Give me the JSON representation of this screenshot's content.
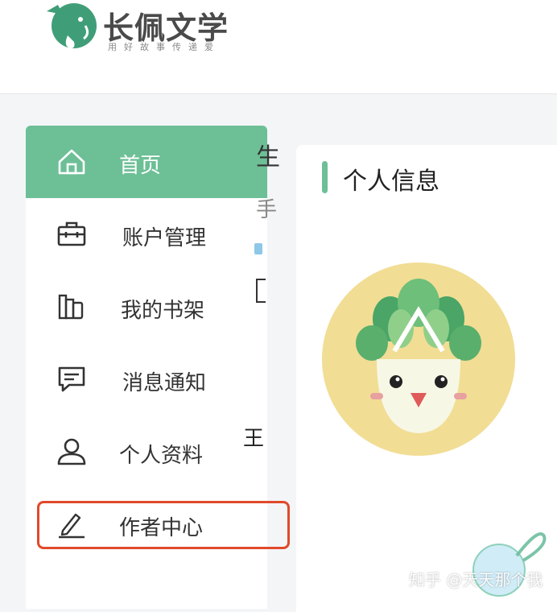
{
  "header": {
    "logo_title": "长佩文学",
    "logo_slogan": "用好故事传递爱"
  },
  "sidebar": {
    "items": [
      {
        "label": "首页",
        "icon": "home-icon",
        "active": true
      },
      {
        "label": "账户管理",
        "icon": "briefcase-icon",
        "active": false
      },
      {
        "label": "我的书架",
        "icon": "bookshelf-icon",
        "active": false
      },
      {
        "label": "消息通知",
        "icon": "message-icon",
        "active": false
      },
      {
        "label": "个人资料",
        "icon": "user-icon",
        "active": false
      },
      {
        "label": "作者中心",
        "icon": "pen-icon",
        "active": false,
        "highlighted": true
      }
    ]
  },
  "main": {
    "section_title": "个人信息",
    "cut_off_text": [
      "生",
      "手",
      "王"
    ]
  },
  "watermark": "知乎 @天天那个我",
  "colors": {
    "accent": "#6dbf96",
    "highlight_border": "#e04a2a",
    "page_bg": "#f4f5f7"
  }
}
